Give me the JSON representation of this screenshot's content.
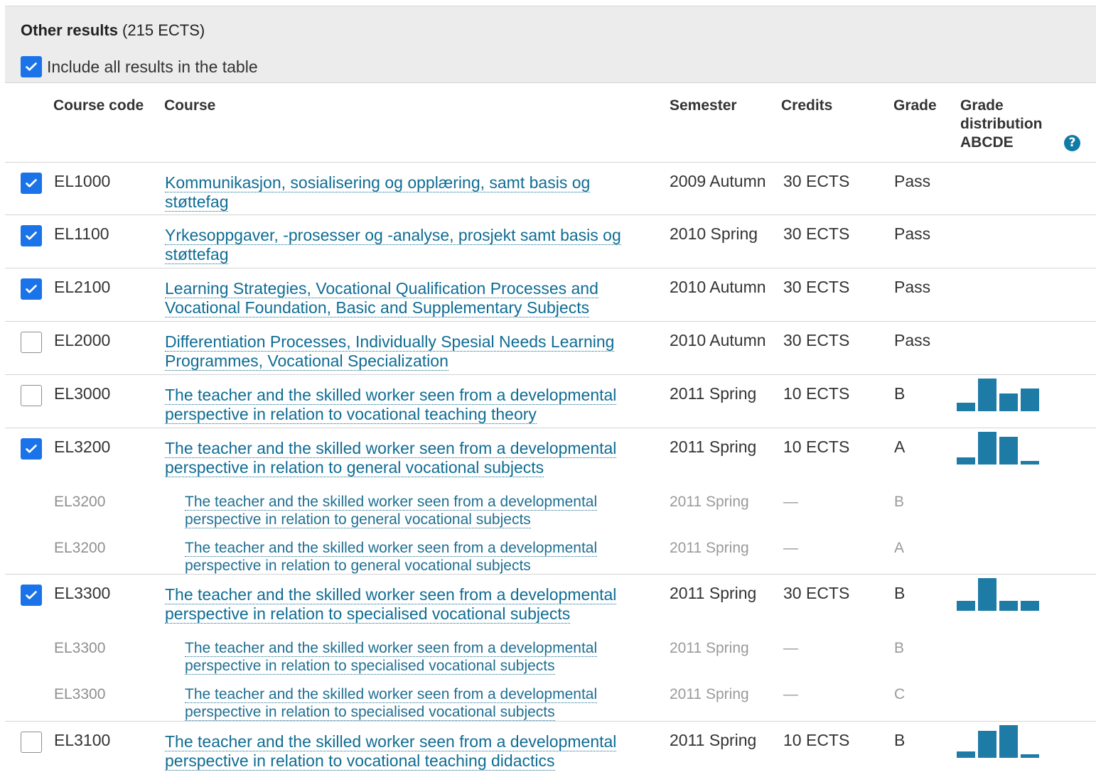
{
  "section": {
    "title_bold": "Other results",
    "title_rest": " (215 ECTS)",
    "include_label": "Include all results in the table",
    "include_checked": true
  },
  "columns": {
    "course_code": "Course code",
    "course": "Course",
    "semester": "Semester",
    "credits": "Credits",
    "grade": "Grade",
    "grade_distribution": [
      "Grade",
      "distribution",
      "ABCDE"
    ],
    "help_icon": "?"
  },
  "icons": {
    "checkbox_checked": "check-icon",
    "help": "question-circle-icon"
  },
  "colors": {
    "accent": "#1a73e8",
    "link": "#0f6c94",
    "bar": "#1d7ba6",
    "panel": "#ececec"
  },
  "rows": [
    {
      "type": "main",
      "checked": true,
      "code": "EL1000",
      "course": "Kommunikasjon, sosialisering og opplæring, samt basis og støttefag",
      "semester": "2009 Autumn",
      "credits": "30 ECTS",
      "grade": "Pass",
      "distribution": null
    },
    {
      "type": "main",
      "checked": true,
      "code": "EL1100",
      "course": "Yrkesoppgaver, -prosesser og -analyse, prosjekt samt basis og støttefag",
      "semester": "2010 Spring",
      "credits": "30 ECTS",
      "grade": "Pass",
      "distribution": null
    },
    {
      "type": "main",
      "checked": true,
      "code": "EL2100",
      "course": "Learning Strategies, Vocational Qualification Processes and Vocational Foundation, Basic and Supplementary Subjects",
      "semester": "2010 Autumn",
      "credits": "30 ECTS",
      "grade": "Pass",
      "distribution": null
    },
    {
      "type": "main",
      "checked": false,
      "code": "EL2000",
      "course": "Differentiation Processes, Individually Spesial Needs Learning Programmes, Vocational Specialization",
      "semester": "2010 Autumn",
      "credits": "30 ECTS",
      "grade": "Pass",
      "distribution": null
    },
    {
      "type": "main",
      "checked": false,
      "code": "EL3000",
      "course": "The teacher and the skilled worker seen from a developmental perspective in relation to vocational teaching theory",
      "semester": "2011 Spring",
      "credits": "10 ECTS",
      "grade": "B",
      "distribution": [
        0.25,
        1.0,
        0.55,
        0.7,
        0
      ]
    },
    {
      "type": "main",
      "checked": true,
      "code": "EL3200",
      "course": "The teacher and the skilled worker seen from a developmental perspective in relation to general vocational subjects",
      "semester": "2011 Spring",
      "credits": "10 ECTS",
      "grade": "A",
      "distribution": [
        0.22,
        1.0,
        0.85,
        0.1,
        0
      ]
    },
    {
      "type": "sub",
      "code": "EL3200",
      "course": "The teacher and the skilled worker seen from a developmental perspective in relation to general vocational subjects",
      "semester": "2011 Spring",
      "credits": "—",
      "grade": "B"
    },
    {
      "type": "sub",
      "code": "EL3200",
      "course": "The teacher and the skilled worker seen from a developmental perspective in relation to general vocational subjects",
      "semester": "2011 Spring",
      "credits": "—",
      "grade": "A"
    },
    {
      "type": "main",
      "checked": true,
      "code": "EL3300",
      "course": "The teacher and the skilled worker seen from a developmental perspective in relation to specialised vocational subjects",
      "semester": "2011 Spring",
      "credits": "30 ECTS",
      "grade": "B",
      "distribution": [
        0.3,
        1.0,
        0.3,
        0.3,
        0
      ]
    },
    {
      "type": "sub",
      "code": "EL3300",
      "course": "The teacher and the skilled worker seen from a developmental perspective in relation to specialised vocational subjects",
      "semester": "2011 Spring",
      "credits": "—",
      "grade": "B"
    },
    {
      "type": "sub",
      "code": "EL3300",
      "course": "The teacher and the skilled worker seen from a developmental perspective in relation to specialised vocational subjects",
      "semester": "2011 Spring",
      "credits": "—",
      "grade": "C"
    },
    {
      "type": "main",
      "checked": false,
      "code": "EL3100",
      "course": "The teacher and the skilled worker seen from a developmental perspective in relation to vocational teaching didactics",
      "semester": "2011 Spring",
      "credits": "10 ECTS",
      "grade": "B",
      "distribution": [
        0.2,
        0.82,
        1.0,
        0.1,
        0
      ]
    }
  ]
}
